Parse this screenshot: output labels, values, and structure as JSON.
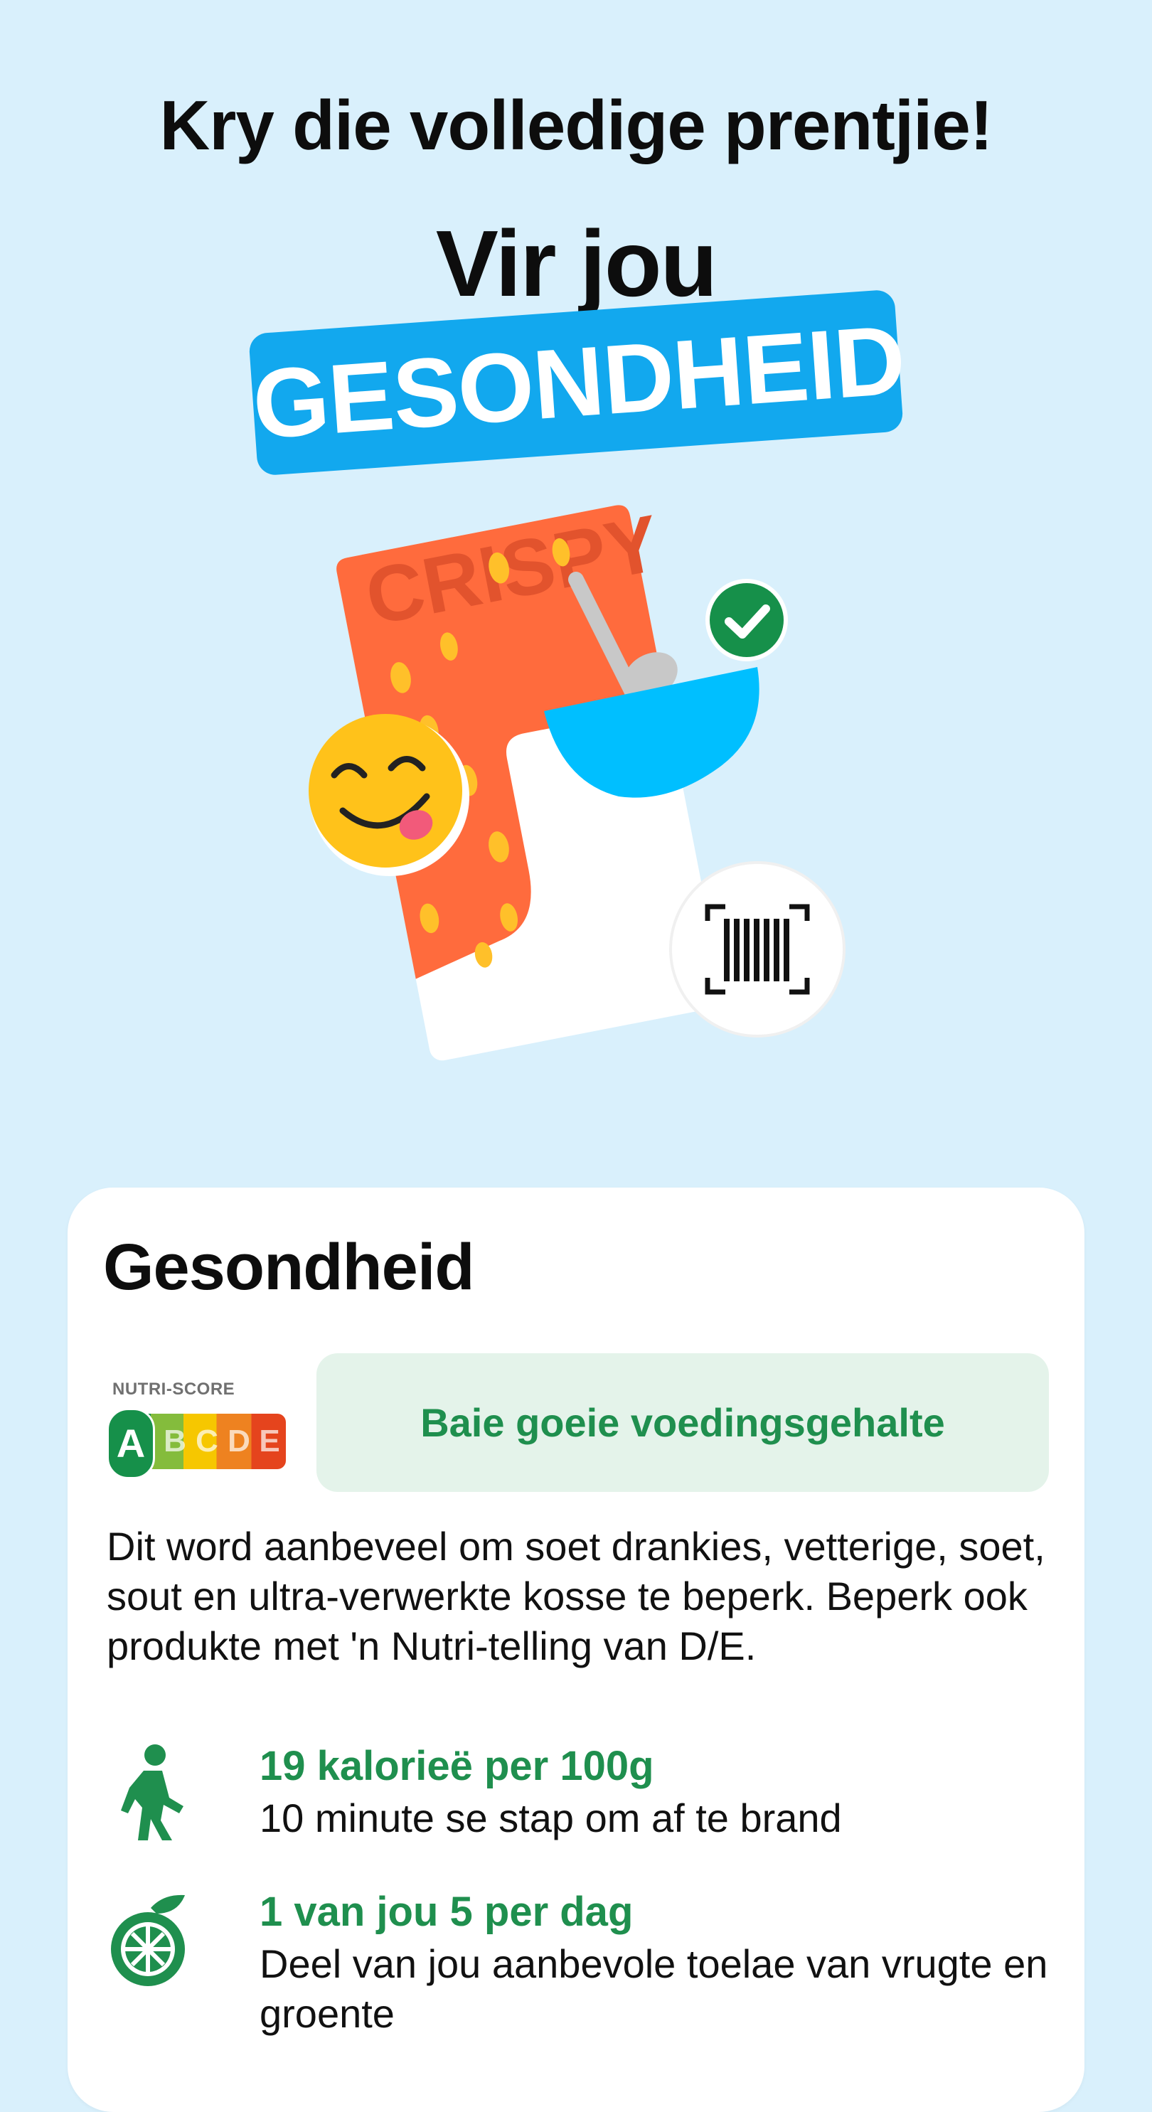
{
  "hero": {
    "headline": "Kry die volledige prentjie!",
    "subhead": "Vir jou",
    "tag": "GESONDHEID",
    "tag_color": "#12a8ee"
  },
  "illustration": {
    "package_text": "CRISPY",
    "icons": [
      "smiley-face-icon",
      "check-badge-icon",
      "barcode-scan-icon",
      "spoon-icon",
      "bowl-icon"
    ]
  },
  "card": {
    "title": "Gesondheid",
    "nutri_score": {
      "label": "NUTRI-SCORE",
      "grades": [
        "A",
        "B",
        "C",
        "D",
        "E"
      ],
      "active": "A",
      "colors": [
        "#16904a",
        "#84bc3c",
        "#f6c700",
        "#ee8220",
        "#e5441d"
      ]
    },
    "verdict": "Baie goeie voedingsgehalte",
    "description": "Dit word aanbeveel om soet drankies, vetterige, soet, sout en ultra-verwerkte kosse te beperk. Beperk ook produkte met 'n Nutri-telling van D/E.",
    "facts": [
      {
        "icon": "walking-person-icon",
        "title": "19 kalorieë per 100g",
        "text": "10 minute se stap om af te brand"
      },
      {
        "icon": "fruit-icon",
        "title": "1 van jou 5 per dag",
        "text": "Deel van jou aanbevole toelae van vrugte en groente"
      }
    ]
  }
}
